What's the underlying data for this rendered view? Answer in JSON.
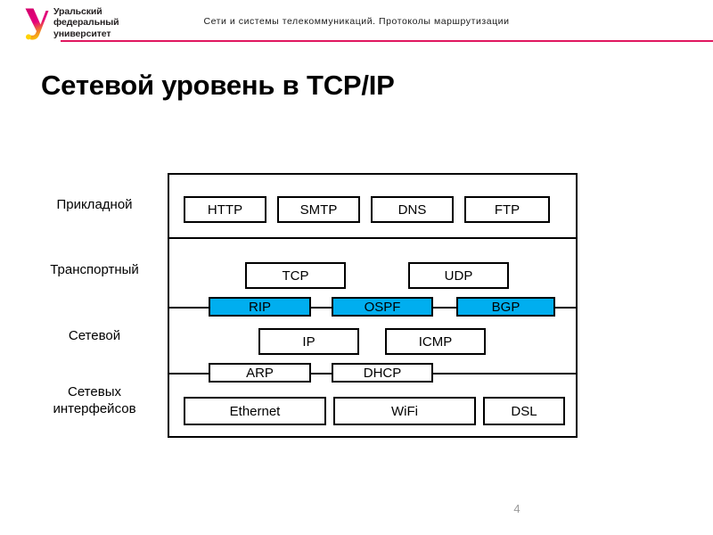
{
  "header": {
    "title": "Сети и системы телекоммуникаций. Протоколы маршрутизации",
    "logo": {
      "mark_name": "ural-federal-university-logo",
      "line1": "Уральский",
      "line2": "федеральный",
      "line3": "университет"
    },
    "rule_color": "#e0175f"
  },
  "slide": {
    "title": "Сетевой уровень в TCP/IP",
    "page_number": "4"
  },
  "diagram": {
    "highlight_color": "#00AEEF",
    "layers": [
      {
        "key": "application",
        "label": "Прикладной"
      },
      {
        "key": "transport",
        "label": "Транспортный"
      },
      {
        "key": "network",
        "label": "Сетевой"
      },
      {
        "key": "interface",
        "label": "Сетевых\nинтерфейсов"
      }
    ],
    "layer_labels": {
      "application": "Прикладной",
      "transport": "Транспортный",
      "network": "Сетевой",
      "interface_line1": "Сетевых",
      "interface_line2": "интерфейсов"
    },
    "protocols": {
      "application": [
        "HTTP",
        "SMTP",
        "DNS",
        "FTP"
      ],
      "transport": [
        "TCP",
        "UDP"
      ],
      "routing_highlighted": [
        "RIP",
        "OSPF",
        "BGP"
      ],
      "network": [
        "IP",
        "ICMP"
      ],
      "network_interface_straddle": [
        "ARP",
        "DHCP"
      ],
      "interface": [
        "Ethernet",
        "WiFi",
        "DSL"
      ]
    },
    "boxes": {
      "http": "HTTP",
      "smtp": "SMTP",
      "dns": "DNS",
      "ftp": "FTP",
      "tcp": "TCP",
      "udp": "UDP",
      "rip": "RIP",
      "ospf": "OSPF",
      "bgp": "BGP",
      "ip": "IP",
      "icmp": "ICMP",
      "arp": "ARP",
      "dhcp": "DHCP",
      "ethernet": "Ethernet",
      "wifi": "WiFi",
      "dsl": "DSL"
    }
  }
}
